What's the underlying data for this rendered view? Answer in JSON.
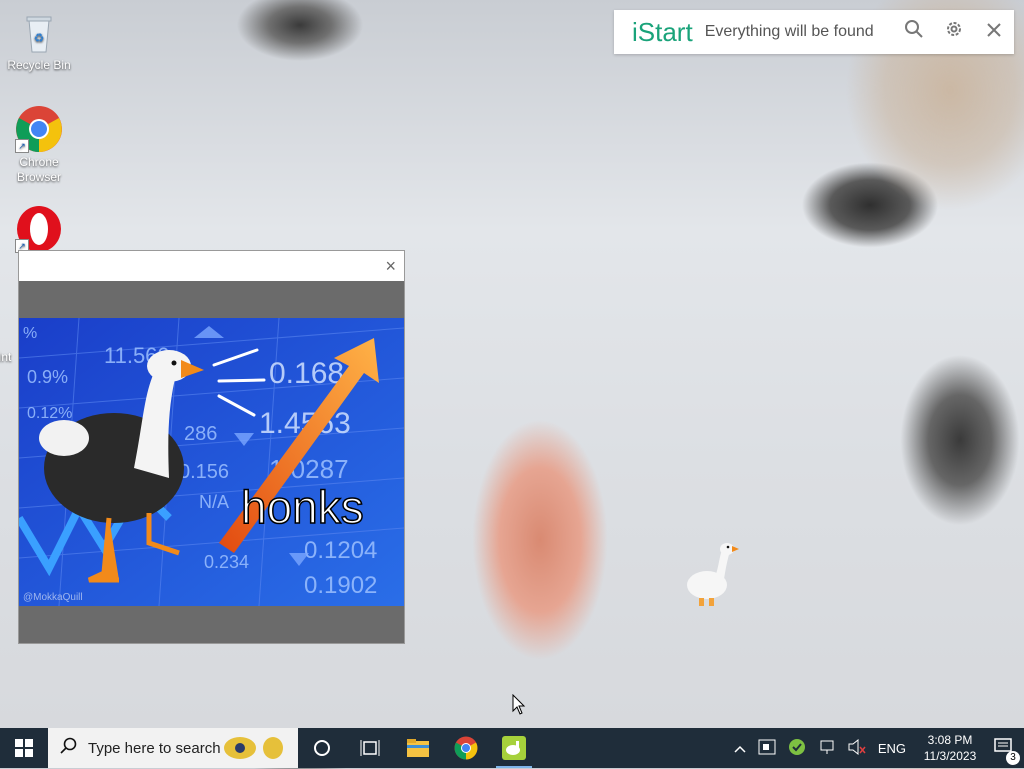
{
  "desktop": {
    "icons": [
      {
        "label": "Recycle Bin",
        "icon": "recycle-bin-icon"
      },
      {
        "label": "Chrone Browser",
        "icon": "chrome-icon"
      },
      {
        "label": "",
        "icon": "opera-icon"
      },
      {
        "label": "Int",
        "icon": "internet-icon"
      }
    ]
  },
  "istart": {
    "logo": "iStart",
    "placeholder": "Everything will be found",
    "accent": "#1aa37a"
  },
  "popup": {
    "close_label": "×",
    "meme": {
      "caption": "honks",
      "watermark": "@MokkaQuill",
      "ticker_values": [
        "11.560",
        "0.168",
        "1.4563",
        "1.0287",
        "0.1204",
        "0.1902",
        "0.234",
        "286",
        "0.156",
        "N/A",
        "0.9%",
        "0.12%",
        "%"
      ]
    }
  },
  "taskbar": {
    "search_placeholder": "Type here to search",
    "tray": {
      "language": "ENG",
      "time": "3:08 PM",
      "date": "11/3/2023",
      "notification_count": "3"
    }
  }
}
